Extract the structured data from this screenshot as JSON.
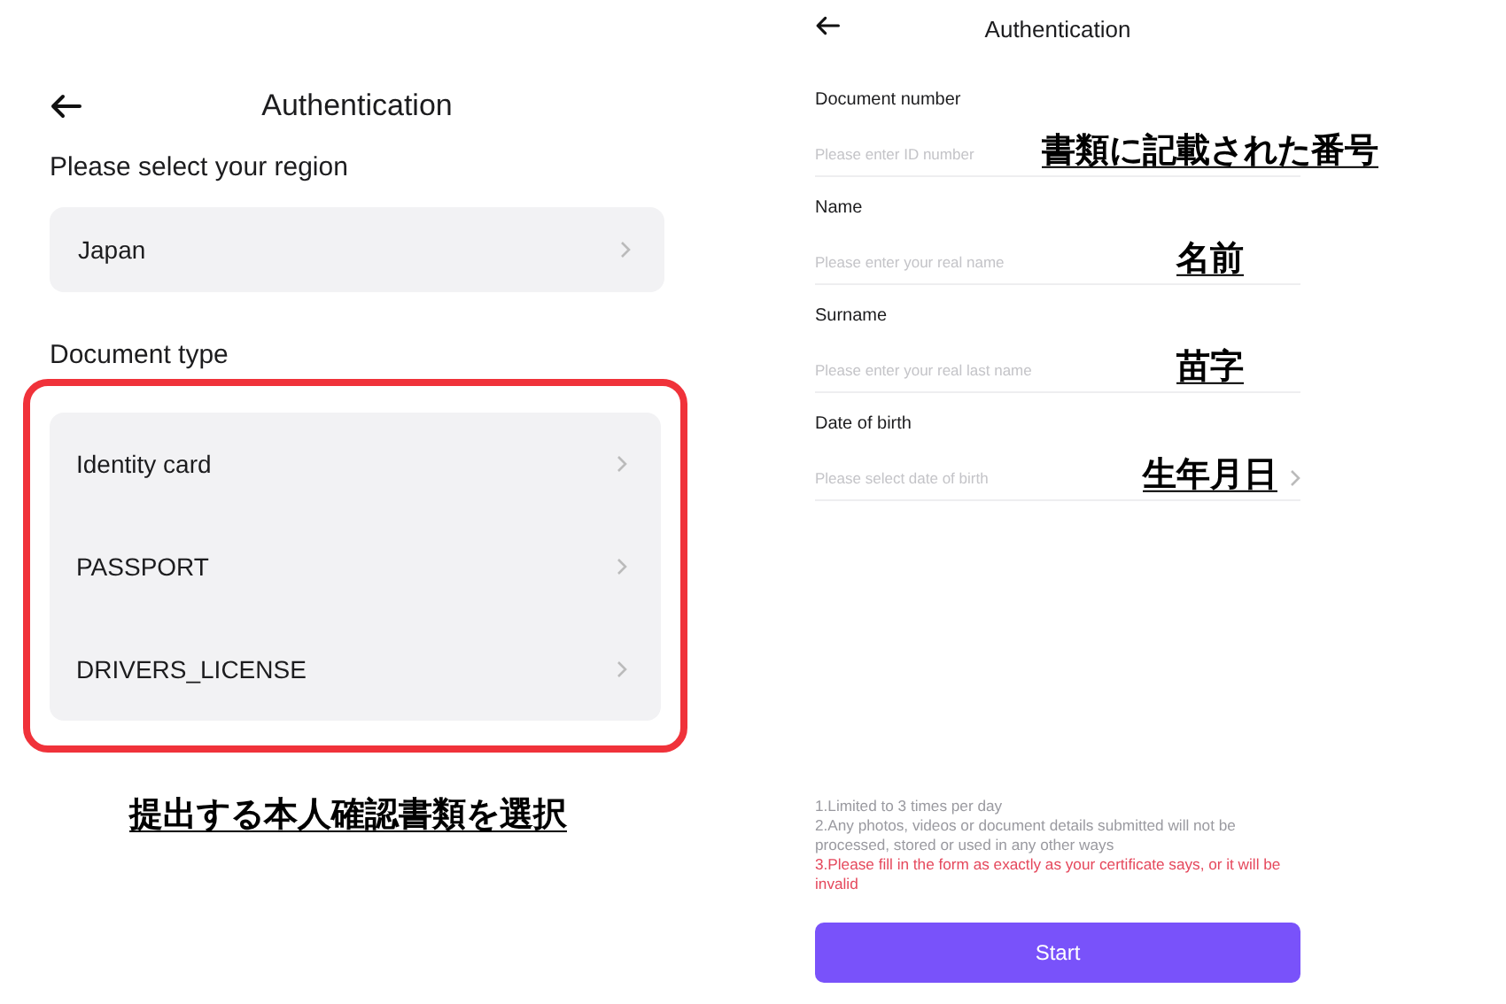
{
  "left_screen": {
    "title": "Authentication",
    "region_label": "Please select your region",
    "region": {
      "value": "Japan"
    },
    "document_type_label": "Document type",
    "document_types": [
      {
        "label": "Identity card"
      },
      {
        "label": "PASSPORT"
      },
      {
        "label": "DRIVERS_LICENSE"
      }
    ],
    "highlighted": true,
    "annotation": "提出する本人確認書類を選択"
  },
  "right_screen": {
    "title": "Authentication",
    "fields": [
      {
        "label": "Document number",
        "placeholder": "Please enter ID number",
        "kind": "text",
        "annotation": "書類に記載された番号"
      },
      {
        "label": "Name",
        "placeholder": "Please enter your real name",
        "kind": "text",
        "annotation": "名前"
      },
      {
        "label": "Surname",
        "placeholder": "Please enter your real last name",
        "kind": "text",
        "annotation": "苗字"
      },
      {
        "label": "Date of birth",
        "placeholder": "Please select date of birth",
        "kind": "select",
        "annotation": "生年月日"
      }
    ],
    "notes": [
      {
        "text": "1.Limited to 3 times per day",
        "kind": "info"
      },
      {
        "text": "2.Any photos, videos or document details submitted will not be processed, stored or used in any other ways",
        "kind": "info"
      },
      {
        "text": "3.Please fill in the form as exactly as your certificate says, or it will be invalid",
        "kind": "warning"
      }
    ],
    "button": "Start"
  }
}
